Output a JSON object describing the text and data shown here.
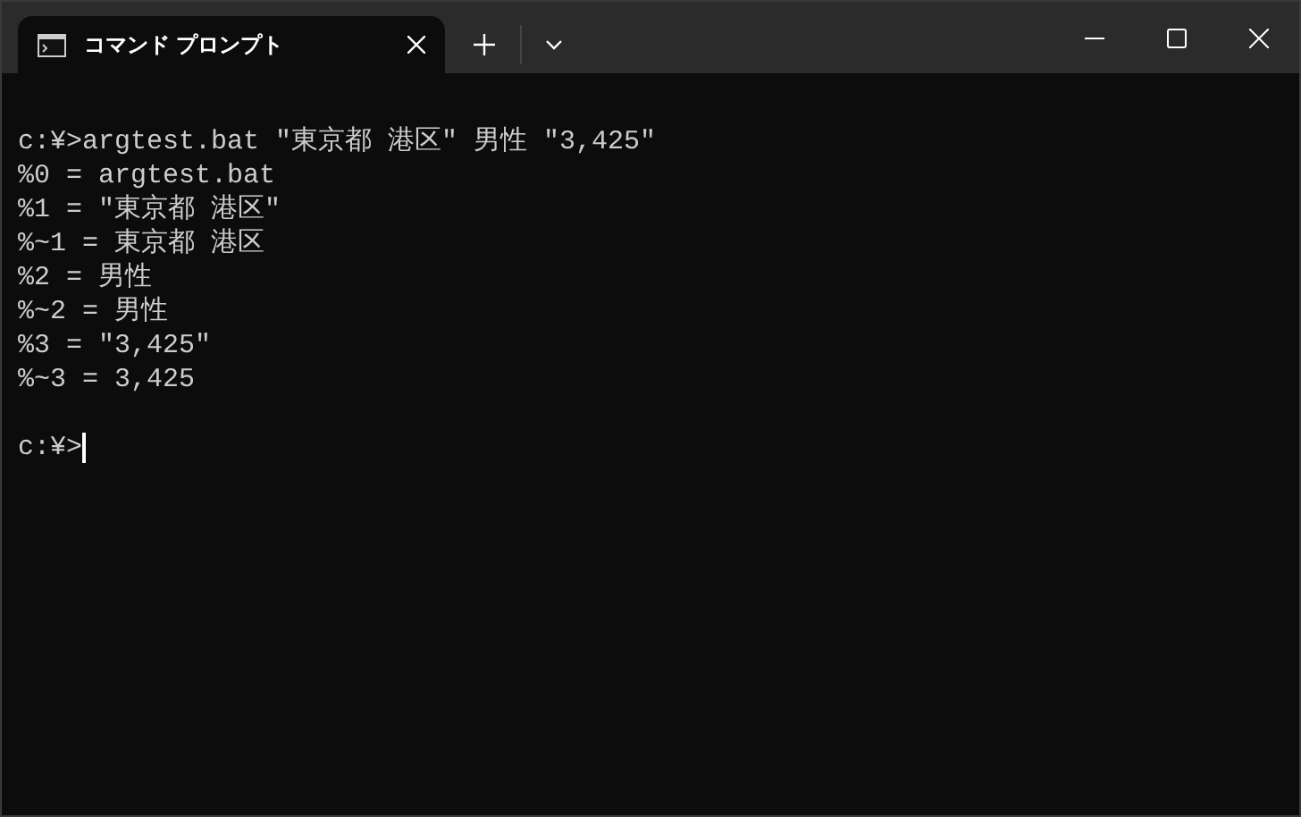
{
  "tabs": [
    {
      "title": "コマンド プロンプト",
      "selected": true
    }
  ],
  "terminal": {
    "lines": [
      "c:¥>argtest.bat \"東京都 港区\" 男性 \"3,425\"",
      "%0 = argtest.bat",
      "%1 = \"東京都 港区\"",
      "%~1 = 東京都 港区",
      "%2 = 男性",
      "%~2 = 男性",
      "%3 = \"3,425\"",
      "%~3 = 3,425"
    ],
    "prompt": "c:¥>"
  }
}
